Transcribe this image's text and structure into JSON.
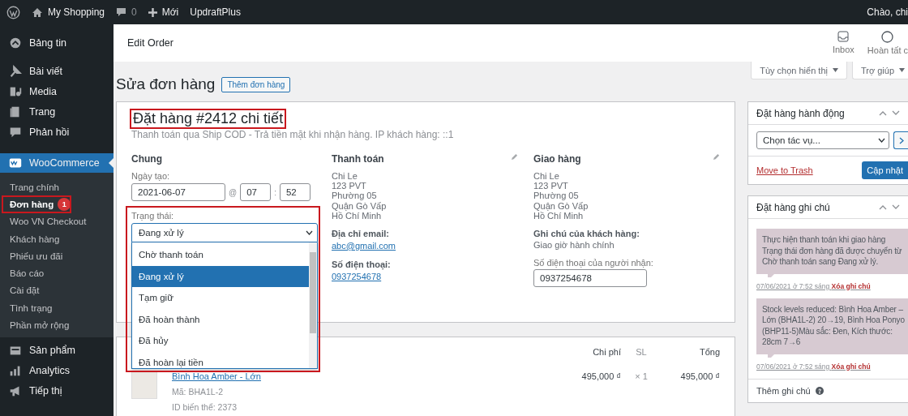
{
  "admin_bar": {
    "site": "My Shopping",
    "comments": "0",
    "new_label": "Mới",
    "plugin": "UpdraftPlus",
    "greeting": "Chào, chi"
  },
  "sidebar": {
    "items": [
      {
        "label": "Bảng tin",
        "selected": false
      },
      {
        "label": "Bài viết",
        "selected": false
      },
      {
        "label": "Media",
        "selected": false
      },
      {
        "label": "Trang",
        "selected": false
      },
      {
        "label": "Phản hồi",
        "selected": false
      },
      {
        "label": "WooCommerce",
        "selected": true,
        "children": [
          {
            "label": "Trang chính",
            "selected": false,
            "highlighted": false
          },
          {
            "label": "Đơn hàng",
            "selected": true,
            "highlighted": true,
            "badge": "1"
          },
          {
            "label": "Woo VN Checkout",
            "selected": false,
            "highlighted": false
          },
          {
            "label": "Khách hàng",
            "selected": false,
            "highlighted": false
          },
          {
            "label": "Phiếu ưu đãi",
            "selected": false,
            "highlighted": false
          },
          {
            "label": "Báo cáo",
            "selected": false,
            "highlighted": false
          },
          {
            "label": "Cài đặt",
            "selected": false,
            "highlighted": false
          },
          {
            "label": "Tình trạng",
            "selected": false,
            "highlighted": false
          },
          {
            "label": "Phần mở rộng",
            "selected": false,
            "highlighted": false
          }
        ]
      },
      {
        "label": "Sản phẩm",
        "selected": false
      },
      {
        "label": "Analytics",
        "selected": false
      },
      {
        "label": "Tiếp thị",
        "selected": false
      }
    ]
  },
  "header": {
    "title": "Edit Order",
    "actions": [
      {
        "label": "Inbox"
      },
      {
        "label": "Hoàn tất c"
      }
    ]
  },
  "screen_tabs": [
    "Tùy chọn hiển thị",
    "Trợ giúp"
  ],
  "page": {
    "title": "Sửa đơn hàng",
    "add_button": "Thêm đơn hàng"
  },
  "order": {
    "heading": "Đặt hàng #2412 chi tiết",
    "heading_highlighted": true,
    "subtitle": "Thanh toán qua Ship COD - Trả tiền mặt khi nhận hàng. IP khách hàng: ::1",
    "general": {
      "title": "Chung",
      "date_label": "Ngày tạo:",
      "date": "2021-06-07",
      "at": "@",
      "hour": "07",
      "separator": ":",
      "minute": "52",
      "status_label": "Trạng thái:",
      "status_value": "Đang xử lý",
      "status_highlighted": true,
      "status_expanded": true,
      "status_options": [
        {
          "label": "Chờ thanh toán",
          "selected": false
        },
        {
          "label": "Đang xử lý",
          "selected": true
        },
        {
          "label": "Tạm giữ",
          "selected": false
        },
        {
          "label": "Đã hoàn thành",
          "selected": false
        },
        {
          "label": "Đã hủy",
          "selected": false
        },
        {
          "label": "Đã hoàn lại tiền",
          "selected": false
        }
      ]
    },
    "billing": {
      "title": "Thanh toán",
      "address": [
        "Chi Le",
        "123 PVT",
        "Phường 05",
        "Quận Gò Vấp",
        "Hồ Chí Minh"
      ],
      "fields": [
        {
          "kind": "link",
          "label": "Địa chỉ email:",
          "value": "abc@gmail.com"
        },
        {
          "kind": "link",
          "label": "Số điện thoại:",
          "value": "0937254678"
        }
      ]
    },
    "shipping": {
      "title": "Giao hàng",
      "address": [
        "Chi Le",
        "123 PVT",
        "Phường 05",
        "Quận Gò Vấp",
        "Hồ Chí Minh"
      ],
      "fields": [
        {
          "kind": "text",
          "label": "Ghi chú của khách hàng:",
          "value": "Giao giờ hành chính"
        },
        {
          "kind": "input",
          "label": "Số điện thoại của người nhận:",
          "value": "0937254678"
        }
      ]
    }
  },
  "items": {
    "columns": [
      "Chi phí",
      "SL",
      "Tổng"
    ],
    "rows": [
      {
        "name": "Bình Hoa Amber - Lớn",
        "sku": "Mã: BHA1L-2",
        "variation": "ID biến thể: 2373",
        "cost": "495,000 ₫",
        "qty": "× 1",
        "total": "495,000 ₫"
      }
    ]
  },
  "actions_box": {
    "title": "Đặt hàng hành động",
    "select_placeholder": "Chọn tác vụ...",
    "trash": "Move to Trash",
    "update": "Cập nhật"
  },
  "notes_box": {
    "title": "Đặt hàng ghi chú",
    "notes": [
      {
        "text": "Thực hiện thanh toán khi giao hàng\nTrạng thái đơn hàng đã được chuyển từ Chờ thanh toán sang Đang xử lý.",
        "date": "07/06/2021 ở 7:52 sáng",
        "delete": "Xóa ghi chú"
      },
      {
        "text": "Stock levels reduced: Bình Hoa Amber – Lớn (BHA1L-2) 20→19, Bình Hoa Ponyo (BHP11-5)Màu sắc: Đen, Kích thước: 28cm 7→6",
        "date": "07/06/2021 ở 7:52 sáng",
        "delete": "Xóa ghi chú"
      }
    ],
    "add_label": "Thêm ghi chú"
  }
}
